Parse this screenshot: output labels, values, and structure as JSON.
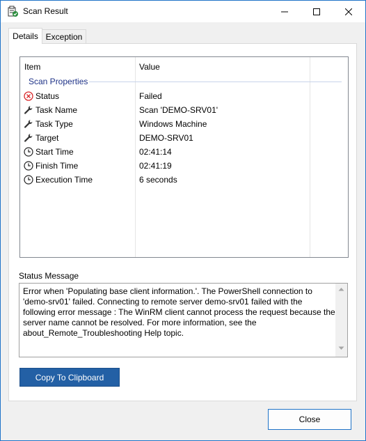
{
  "window": {
    "title": "Scan Result",
    "controls": {
      "minimize": "minimize",
      "maximize": "maximize",
      "close": "close"
    }
  },
  "tabs": [
    {
      "label": "Details",
      "active": true
    },
    {
      "label": "Exception",
      "active": false
    }
  ],
  "list": {
    "columns": [
      "Item",
      "Value"
    ],
    "group": "Scan Properties",
    "rows": [
      {
        "icon": "error-icon",
        "label": "Status",
        "value": "Failed"
      },
      {
        "icon": "wrench-icon",
        "label": "Task Name",
        "value": "Scan 'DEMO-SRV01'"
      },
      {
        "icon": "wrench-icon",
        "label": "Task Type",
        "value": "Windows Machine"
      },
      {
        "icon": "wrench-icon",
        "label": "Target",
        "value": "DEMO-SRV01"
      },
      {
        "icon": "clock-icon",
        "label": "Start Time",
        "value": "02:41:14"
      },
      {
        "icon": "clock-icon",
        "label": "Finish Time",
        "value": "02:41:19"
      },
      {
        "icon": "clock-icon",
        "label": "Execution Time",
        "value": "6 seconds"
      }
    ]
  },
  "status": {
    "label": "Status Message",
    "message": "Error when 'Populating base client information.'. The PowerShell connection to 'demo-srv01' failed. Connecting to remote server demo-srv01 failed with the following error message : The WinRM client cannot process the request because the server name cannot be resolved. For more information, see the about_Remote_Troubleshooting Help topic."
  },
  "buttons": {
    "copy": "Copy To Clipboard",
    "close": "Close"
  },
  "colors": {
    "accent": "#2360a5",
    "border_focus": "#1f73c8",
    "group_text": "#1e3287",
    "error": "#d9282b"
  }
}
